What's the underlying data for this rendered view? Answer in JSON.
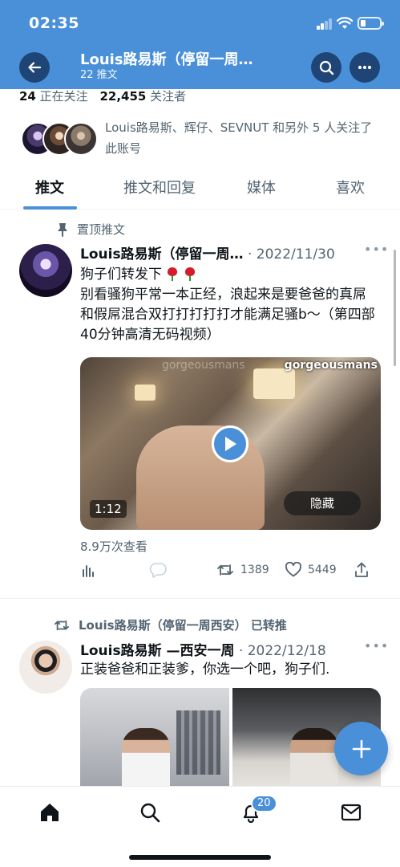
{
  "status_bar": {
    "time": "02:35"
  },
  "header": {
    "title": "Louis路易斯（停留一周…",
    "subtitle": "22 推文",
    "back_icon": "arrow-left-icon",
    "search_icon": "search-icon",
    "more_icon": "more-icon"
  },
  "profile": {
    "following_count": "24",
    "following_label": "正在关注",
    "followers_count": "22,455",
    "followers_label": "关注者",
    "followed_by": "Louis路易斯、辉仔、SEVNUT 和另外 5 人关注了此账号"
  },
  "tabs": [
    "推文",
    "推文和回复",
    "媒体",
    "喜欢"
  ],
  "pinned": {
    "label": "置顶推文",
    "author": "Louis路易斯（停留一周…",
    "date": "· 2022/11/30",
    "line1": "狗子们转发下",
    "body": "别看骚狗平常一本正经，浪起来是要爸爸的真屌和假屌混合双打打打打打才能满足骚b～（第四部40分钟高清无码视频）",
    "video": {
      "watermark": "gorgeousmans",
      "watermark_faint": "gorgeousmans",
      "duration": "1:12",
      "hide_label": "隐藏"
    },
    "views": "8.9万次查看",
    "retweets": "1389",
    "likes": "5449"
  },
  "retweet": {
    "label": "Louis路易斯（停留一周西安） 已转推",
    "author": "Louis路易斯 —西安一周",
    "date": "· 2022/12/18",
    "body": "正装爸爸和正装爹，你选一个吧，狗子们."
  },
  "nav": {
    "notification_badge": "20"
  },
  "colors": {
    "accent": "#4a90d9",
    "text": "#0f1419",
    "muted": "#536471"
  }
}
